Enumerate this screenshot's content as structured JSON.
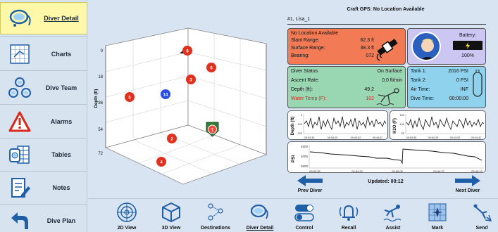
{
  "sidebar": {
    "items": [
      {
        "label": "Diver Detail",
        "icon": "diver-mask-icon",
        "active": true
      },
      {
        "label": "Charts",
        "icon": "chart-grid-icon"
      },
      {
        "label": "Dive Team",
        "icon": "dive-team-icon"
      },
      {
        "label": "Alarms",
        "icon": "warning-triangle-icon"
      },
      {
        "label": "Tables",
        "icon": "tables-icon"
      },
      {
        "label": "Notes",
        "icon": "notes-icon"
      },
      {
        "label": "Dive Plan",
        "icon": "back-arrow-icon"
      }
    ]
  },
  "plot": {
    "axis_title": "Depth (ft)",
    "depth_ticks": [
      "0",
      "18",
      "36",
      "54",
      "72"
    ],
    "markers": [
      {
        "label": "8",
        "kind": "red"
      },
      {
        "label": "6",
        "kind": "red"
      },
      {
        "label": "3",
        "kind": "red"
      },
      {
        "label": "5",
        "kind": "red"
      },
      {
        "label": "14",
        "kind": "blue"
      },
      {
        "label": "8",
        "kind": "red"
      },
      {
        "label": "2",
        "kind": "red"
      },
      {
        "label": "4",
        "kind": "red"
      },
      {
        "label": "1",
        "kind": "selected"
      }
    ]
  },
  "gps_status": "Craft GPS: No Location Available",
  "diver_name": "#1, Lisa_1",
  "location": {
    "header": "No Location Available",
    "rows": [
      {
        "label": "Slant Range:",
        "value": "62.3 ft"
      },
      {
        "label": "Surface Range:",
        "value": "38.3 ft"
      },
      {
        "label": "Bearing:",
        "value": "072"
      }
    ]
  },
  "profile": {
    "battery_label": "Battery:",
    "battery_value": "100%"
  },
  "status": {
    "rows": [
      {
        "label": "Diver Status",
        "value": "On Surface"
      },
      {
        "label": "Ascent Rate:",
        "value": "0.0 ft/min"
      },
      {
        "label": "Depth (ft):",
        "value": "49.2"
      },
      {
        "label": "Water Temp (F):",
        "value": "102"
      }
    ]
  },
  "tank": {
    "rows": [
      {
        "label": "Tank 1:",
        "value": "2016 PSI"
      },
      {
        "label": "Tank 2:",
        "value": "0 PSI"
      },
      {
        "label": "Air Time:",
        "value": "INF"
      },
      {
        "label": "Dive Time:",
        "value": "00:00:00"
      }
    ]
  },
  "charts": {
    "depth": {
      "ylabel": "Depth (ft)",
      "yticks": [
        "0",
        "100",
        "200"
      ],
      "xticks": [
        "09:53:35",
        "09:54:25",
        "09:43:52",
        "09:44:42"
      ]
    },
    "h2o": {
      "ylabel": "H2O (F)",
      "yticks": [
        "150",
        "100",
        "50"
      ],
      "xticks": [
        "09:53:35",
        "09:54:25",
        "09:43:52",
        "09:44:42"
      ]
    },
    "psi": {
      "ylabel": "PSI",
      "yticks": [
        "4500",
        "4000",
        "3500"
      ],
      "xticks": [
        "09:53:35",
        "09:54:20",
        "09:55:05",
        "09:44:27",
        "09:45:12"
      ]
    }
  },
  "nav": {
    "prev": "Prev Diver",
    "next": "Next Diver",
    "updated": "Updated: 00:12"
  },
  "tabs": [
    {
      "label": "2D View",
      "icon": "target-icon"
    },
    {
      "label": "3D View",
      "icon": "cube-icon"
    },
    {
      "label": "Destinations",
      "icon": "destinations-icon"
    },
    {
      "label": "Diver Detail",
      "icon": "diver-mask-icon",
      "active": true
    },
    {
      "label": "Control",
      "icon": "toggle-switches-icon"
    },
    {
      "label": "Recall",
      "icon": "recall-bell-icon"
    },
    {
      "label": "Assist",
      "icon": "assist-diver-icon"
    },
    {
      "label": "Mark",
      "icon": "mark-icon"
    },
    {
      "label": "Send",
      "icon": "send-icon"
    }
  ],
  "colors": {
    "accent": "#1f5fa8",
    "active": "#fff8a8",
    "alert": "#f27a55",
    "status": "#98d7b2",
    "tank": "#8fd2ee",
    "profile": "#ccc6f2",
    "marker": "#e0301e"
  }
}
